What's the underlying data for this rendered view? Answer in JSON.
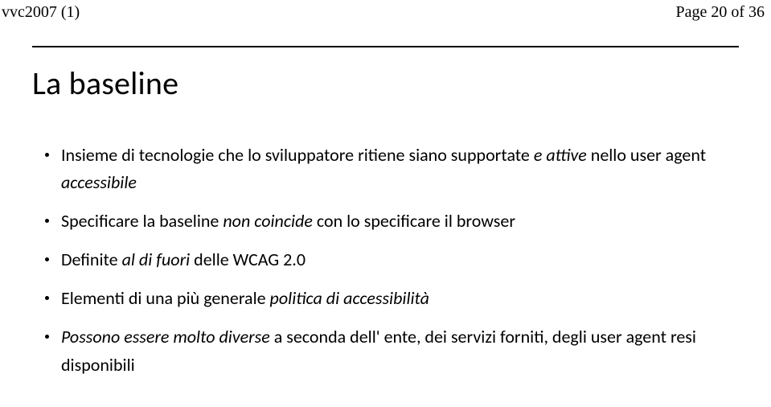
{
  "header": {
    "left": "vvc2007 (1)",
    "right": "Page 20 of 36"
  },
  "title": "La baseline",
  "bullets": [
    {
      "pre": "Insieme di tecnologie che lo sviluppatore ritiene siano supportate ",
      "em1": "e attive",
      "mid": " nello user agent ",
      "em2": "accessibile",
      "post": ""
    },
    {
      "pre": "Specificare la baseline ",
      "em1": "non coincide",
      "mid": " con lo specificare il browser",
      "em2": "",
      "post": ""
    },
    {
      "pre": "Definite ",
      "em1": "al di fuori",
      "mid": " delle WCAG 2.0",
      "em2": "",
      "post": ""
    },
    {
      "pre": "Elementi di una più generale ",
      "em1": "politica di accessibilità",
      "mid": "",
      "em2": "",
      "post": ""
    },
    {
      "pre": "",
      "em1": "Possono essere molto diverse",
      "mid": " a seconda dell' ente, dei servizi forniti, degli user agent resi disponibili",
      "em2": "",
      "post": ""
    }
  ]
}
